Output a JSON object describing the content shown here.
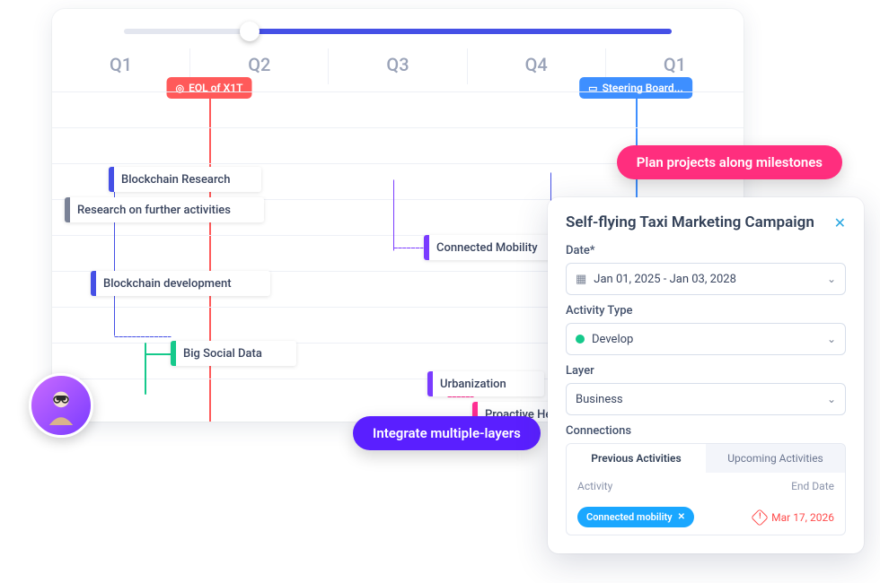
{
  "timeline": {
    "quarters": [
      "Q1",
      "Q2",
      "Q3",
      "Q4",
      "Q1"
    ],
    "milestones": {
      "eol": {
        "label": "EOL of X1T",
        "icon": "◎"
      },
      "steering": {
        "label": "Steering Board...",
        "icon": "▭"
      }
    },
    "tasks": {
      "research_further": "Research on further activities",
      "blockchain_research": "Blockchain Research",
      "connected_mobility": "Connected Mobility",
      "blockchain_dev": "Blockchain development",
      "big_social": "Big Social Data",
      "urbanization": "Urbanization",
      "proactive_health": "Proactive Health Enf"
    }
  },
  "callouts": {
    "plan": "Plan projects along milestones",
    "integrate": "Integrate multiple-layers"
  },
  "panel": {
    "title": "Self-flying Taxi Marketing Campaign",
    "date_label": "Date*",
    "date_value": "Jan 01, 2025 - Jan 03, 2028",
    "activity_label": "Activity Type",
    "activity_value": "Develop",
    "layer_label": "Layer",
    "layer_value": "Business",
    "connections_label": "Connections",
    "tabs": {
      "prev": "Previous Activities",
      "upcoming": "Upcoming Activities"
    },
    "table": {
      "col_activity": "Activity",
      "col_end": "End Date",
      "chip": "Connected mobility",
      "enddate": "Mar 17, 2026"
    }
  }
}
